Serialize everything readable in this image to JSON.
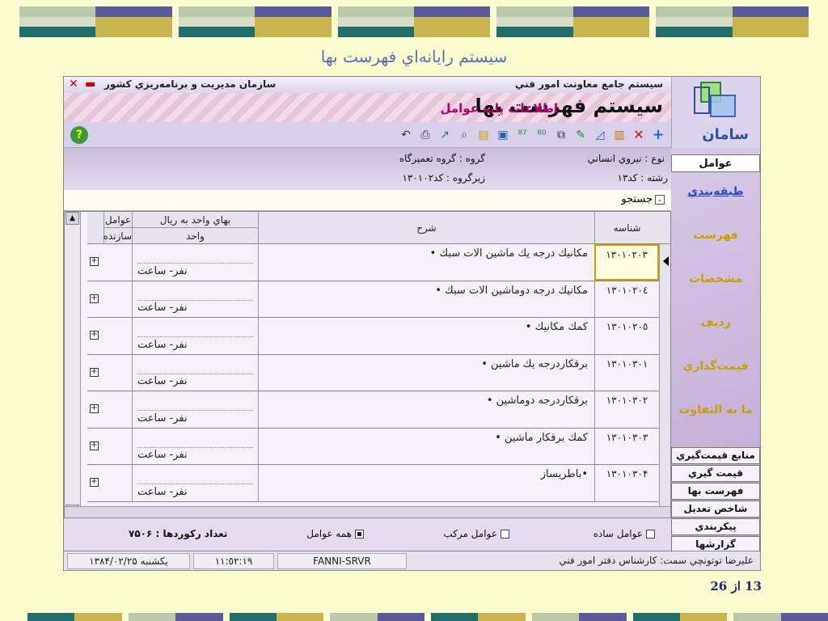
{
  "slide": {
    "title": "سيستم رايانه‌اي فهرست بها",
    "page_number": "13",
    "page_of": "از",
    "page_total": "26",
    "band_colors": [
      "#1f6e6c",
      "#c9b44f",
      "#b9c8a8",
      "#5a5a9a"
    ]
  },
  "app": {
    "titlebar_right": "سيستم جامع معاونت امور فني",
    "titlebar_left": "سازمان مديريت و برنامه‌ريزي كشور",
    "banner_title": "سيستم فهرست بها",
    "banner_subtitle": "اطلاعات پايه عوامل",
    "logo_text": "سامان",
    "toolbar_icons": [
      "add-icon",
      "delete-icon",
      "books-icon",
      "chart-icon",
      "pencil-icon",
      "copy-icon",
      "edit-icon",
      "edit-alt-icon",
      "image-icon",
      "folder-icon",
      "search-icon",
      "export-icon",
      "print-icon",
      "undo-icon"
    ],
    "help_label": "?",
    "info": {
      "type_label": "نوع : نيروي انساني",
      "group_label": "گروه : گروه تعميرگاه",
      "branch_label": "رشته : كد١٣",
      "subgroup_label": "زيرگروه : كد١٣٠١٠٢"
    },
    "search_label": "جستجو",
    "right_menu": {
      "selected": "عوامل",
      "links": [
        "طبقه‌بندي",
        "فهرست",
        "مشخصات",
        "رديف",
        "قيمت‌گذاري",
        "ما به التفاوت"
      ],
      "buttons": [
        "منابع قيمت‌گيري",
        "قيمت گيري",
        "فهرست بها",
        "شاخص تعديل",
        "پيكربندي",
        "گزارشها"
      ]
    },
    "grid": {
      "headers": {
        "id": "شناسه",
        "desc": "شرح",
        "price_top": "بهاي واحد به ريال",
        "price_unit": "واحد",
        "factors_top": "عوامل",
        "factors_bottom": "سازنده"
      },
      "rows": [
        {
          "id": "١٣٠١٠٢٠٣",
          "desc": "مكانيك درجه يك ماشين الات سبك •",
          "unit": "نفر- ساعت",
          "expand": "+"
        },
        {
          "id": "١٣٠١٠٢٠٤",
          "desc": "مكانيك درجه دوماشين الات سبك •",
          "unit": "نفر- ساعت",
          "expand": "+"
        },
        {
          "id": "١٣٠١٠٢٠٥",
          "desc": "كمك مكانيك •",
          "unit": "نفر- ساعت",
          "expand": "+"
        },
        {
          "id": "١٣٠١٠٣٠١",
          "desc": "برقكاردرجه يك ماشين •",
          "unit": "نفر- ساعت",
          "expand": "+"
        },
        {
          "id": "١٣٠١٠٣٠٢",
          "desc": "برقكاردرجه دوماشين •",
          "unit": "نفر- ساعت",
          "expand": "+"
        },
        {
          "id": "١٣٠١٠٣٠٣",
          "desc": "كمك برقكار ماشين •",
          "unit": "نفر- ساعت",
          "expand": "+"
        },
        {
          "id": "١٣٠١٠٣٠۴",
          "desc": "•باطريساز",
          "unit": "نفر- ساعت",
          "expand": "+"
        }
      ]
    },
    "options": {
      "simple": "عوامل ساده",
      "compound": "عوامل مركب",
      "all": "همه عوامل",
      "selected": "all",
      "record_count": "تعداد ركوردها : ٧۵٠۶"
    },
    "status": {
      "user": "عليرضا توتونچي   سمت: كارشناس دفتر امور فني",
      "server": "FANNI-SRVR",
      "time": "١١:٥٢:١٩",
      "date": "يكشنبه ١٣٨۴/٠٢/٢۵"
    }
  }
}
